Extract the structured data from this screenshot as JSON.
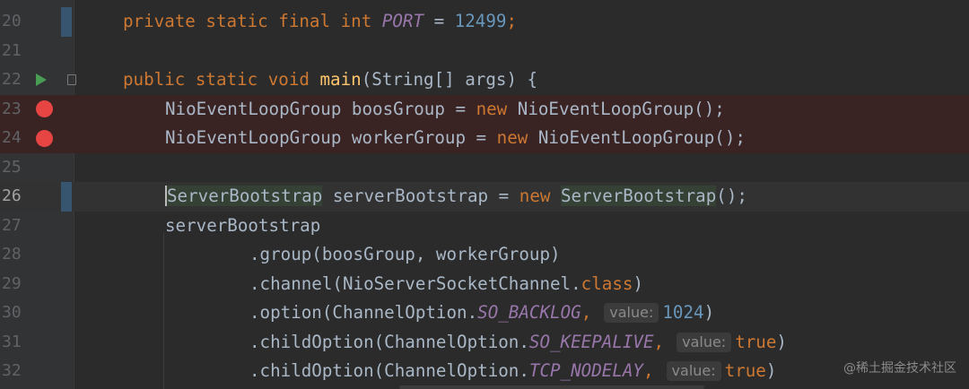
{
  "lines": [
    {
      "num": "20",
      "parts": {
        "a": "private static final int ",
        "b": "PORT",
        "c": " = ",
        "d": "12499",
        ";": ";"
      }
    },
    {
      "num": "21"
    },
    {
      "num": "22",
      "parts": {
        "a": "public static void ",
        "b": "main",
        "c": "(String[] args) {"
      }
    },
    {
      "num": "23",
      "parts": {
        "a": "NioEventLoopGroup boosGroup = ",
        "b": "new",
        "c": " NioEventLoopGroup();"
      }
    },
    {
      "num": "24",
      "parts": {
        "a": "NioEventLoopGroup workerGroup = ",
        "b": "new",
        "c": " NioEventLoopGroup();"
      }
    },
    {
      "num": "25"
    },
    {
      "num": "26",
      "parts": {
        "a": "ServerBootstrap",
        "b": " serverBootstrap = ",
        "c": "new",
        "d": " ",
        "e": "ServerBootstrap",
        "f": "();"
      }
    },
    {
      "num": "27",
      "parts": {
        "a": "serverBootstrap"
      }
    },
    {
      "num": "28",
      "parts": {
        "a": ".group(boosGroup, workerGroup)"
      }
    },
    {
      "num": "29",
      "parts": {
        "a": ".channel(NioServerSocketChannel.",
        "b": "class",
        "c": ")"
      }
    },
    {
      "num": "30",
      "parts": {
        "a": ".option(ChannelOption.",
        "b": "SO_BACKLOG",
        "c": ",",
        "hint": "value:",
        "d": "1024",
        "e": ")"
      }
    },
    {
      "num": "31",
      "parts": {
        "a": ".childOption(ChannelOption.",
        "b": "SO_KEEPALIVE",
        "c": ",",
        "hint": "value:",
        "d": "true",
        "e": ")"
      }
    },
    {
      "num": "32",
      "parts": {
        "a": ".childOption(ChannelOption.",
        "b": "TCP_NODELAY",
        "c": ",",
        "hint": "value:",
        "d": "true",
        "e": ")"
      }
    }
  ],
  "watermark": "@稀土掘金技术社区",
  "colors": {
    "background": "#2b2b2b",
    "keyword": "#cc7832",
    "constant": "#9876aa",
    "number": "#6897bb",
    "method": "#ffc66d",
    "text": "#a9b7c6",
    "breakpoint": "#e74444",
    "run": "#499c54"
  },
  "icons": {
    "run": "run-gutter-icon",
    "breakpoint": "breakpoint-icon",
    "fold": "fold-icon"
  }
}
